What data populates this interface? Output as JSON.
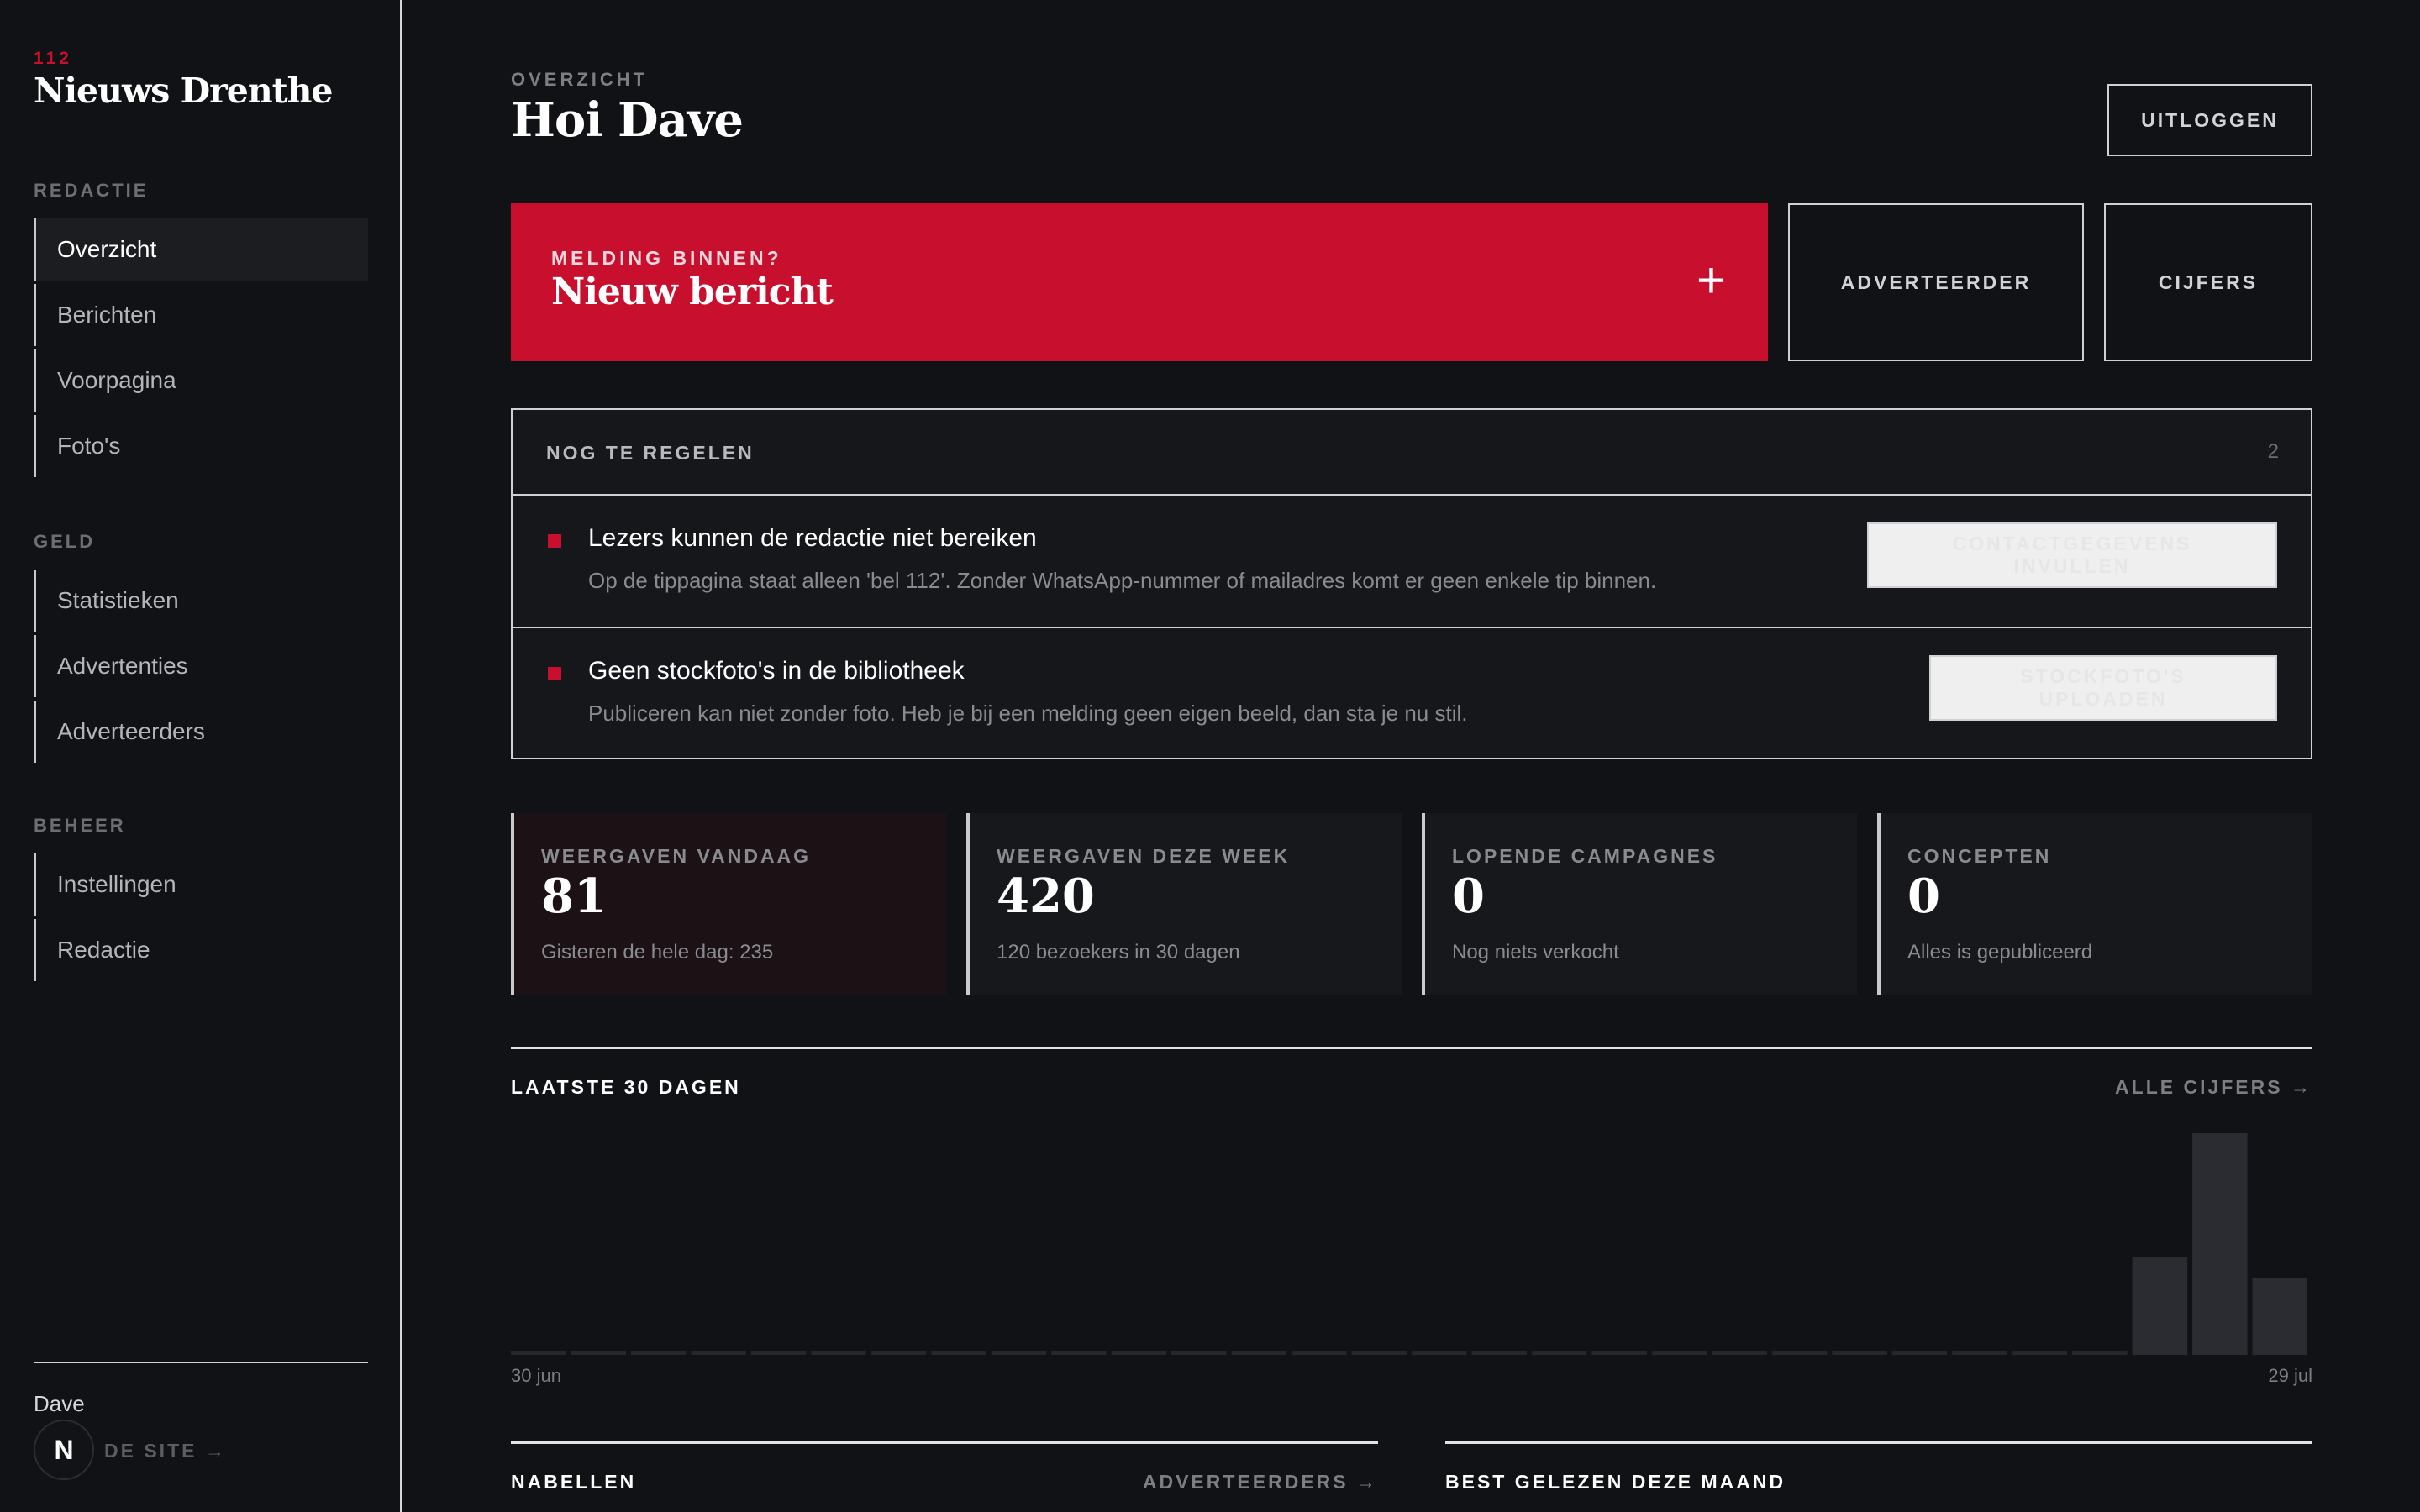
{
  "brand": {
    "kicker": "112",
    "name": "Nieuws Drenthe"
  },
  "sidebar": {
    "sections": [
      {
        "heading": "REDACTIE",
        "items": [
          "Overzicht",
          "Berichten",
          "Voorpagina",
          "Foto's"
        ]
      },
      {
        "heading": "GELD",
        "items": [
          "Statistieken",
          "Advertenties",
          "Adverteerders"
        ]
      },
      {
        "heading": "BEHEER",
        "items": [
          "Instellingen",
          "Redactie"
        ]
      }
    ],
    "active_item": "Overzicht",
    "user": "Dave",
    "avatar_letter": "N",
    "site_link": "DE SITE →"
  },
  "header": {
    "kicker": "OVERZICHT",
    "title": "Hoi Dave",
    "logout": "UITLOGGEN"
  },
  "actions": {
    "new_message_kicker": "MELDING BINNEN?",
    "new_message_title": "Nieuw bericht",
    "new_message_icon": "+",
    "advertiser": "ADVERTEERDER",
    "figures": "CIJFERS"
  },
  "todo": {
    "title": "NOG TE REGELEN",
    "count": "2",
    "items": [
      {
        "title": "Lezers kunnen de redactie niet bereiken",
        "desc": "Op de tippagina staat alleen 'bel 112'. Zonder WhatsApp-nummer of mailadres komt er geen enkele tip binnen.",
        "action": "CONTACTGEGEVENS INVULLEN"
      },
      {
        "title": "Geen stockfoto's in de bibliotheek",
        "desc": "Publiceren kan niet zonder foto. Heb je bij een melding geen eigen beeld, dan sta je nu stil.",
        "action": "STOCKFOTO'S UPLOADEN"
      }
    ]
  },
  "stats": [
    {
      "label": "WEERGAVEN VANDAAG",
      "value": "81",
      "sub": "Gisteren de hele dag: 235"
    },
    {
      "label": "WEERGAVEN DEZE WEEK",
      "value": "420",
      "sub": "120 bezoekers in 30 dagen"
    },
    {
      "label": "LOPENDE CAMPAGNES",
      "value": "0",
      "sub": "Nog niets verkocht"
    },
    {
      "label": "CONCEPTEN",
      "value": "0",
      "sub": "Alles is gepubliceerd"
    }
  ],
  "chart_section": {
    "title": "LAATSTE 30 DAGEN",
    "link": "ALLE CIJFERS →",
    "start_label": "30 jun",
    "end_label": "29 jul"
  },
  "chart_data": {
    "type": "bar",
    "title": "",
    "xlabel": "",
    "ylabel": "",
    "x_start": "30 jun",
    "x_end": "29 jul",
    "values": [
      0,
      0,
      0,
      0,
      0,
      0,
      0,
      0,
      0,
      0,
      0,
      0,
      0,
      0,
      0,
      0,
      0,
      0,
      0,
      0,
      0,
      0,
      0,
      0,
      0,
      0,
      0,
      104,
      235,
      81
    ],
    "ylim": [
      0,
      235
    ],
    "grid": false,
    "bar_color": "#2b2c31",
    "zero_color": "#26272b"
  },
  "bottom": {
    "left_title": "NABELLEN",
    "left_link": "ADVERTEERDERS →",
    "right_title": "BEST GELEZEN DEZE MAAND"
  },
  "colors": {
    "accent": "#c8102e",
    "background": "#111215",
    "panel": "#16171a"
  }
}
